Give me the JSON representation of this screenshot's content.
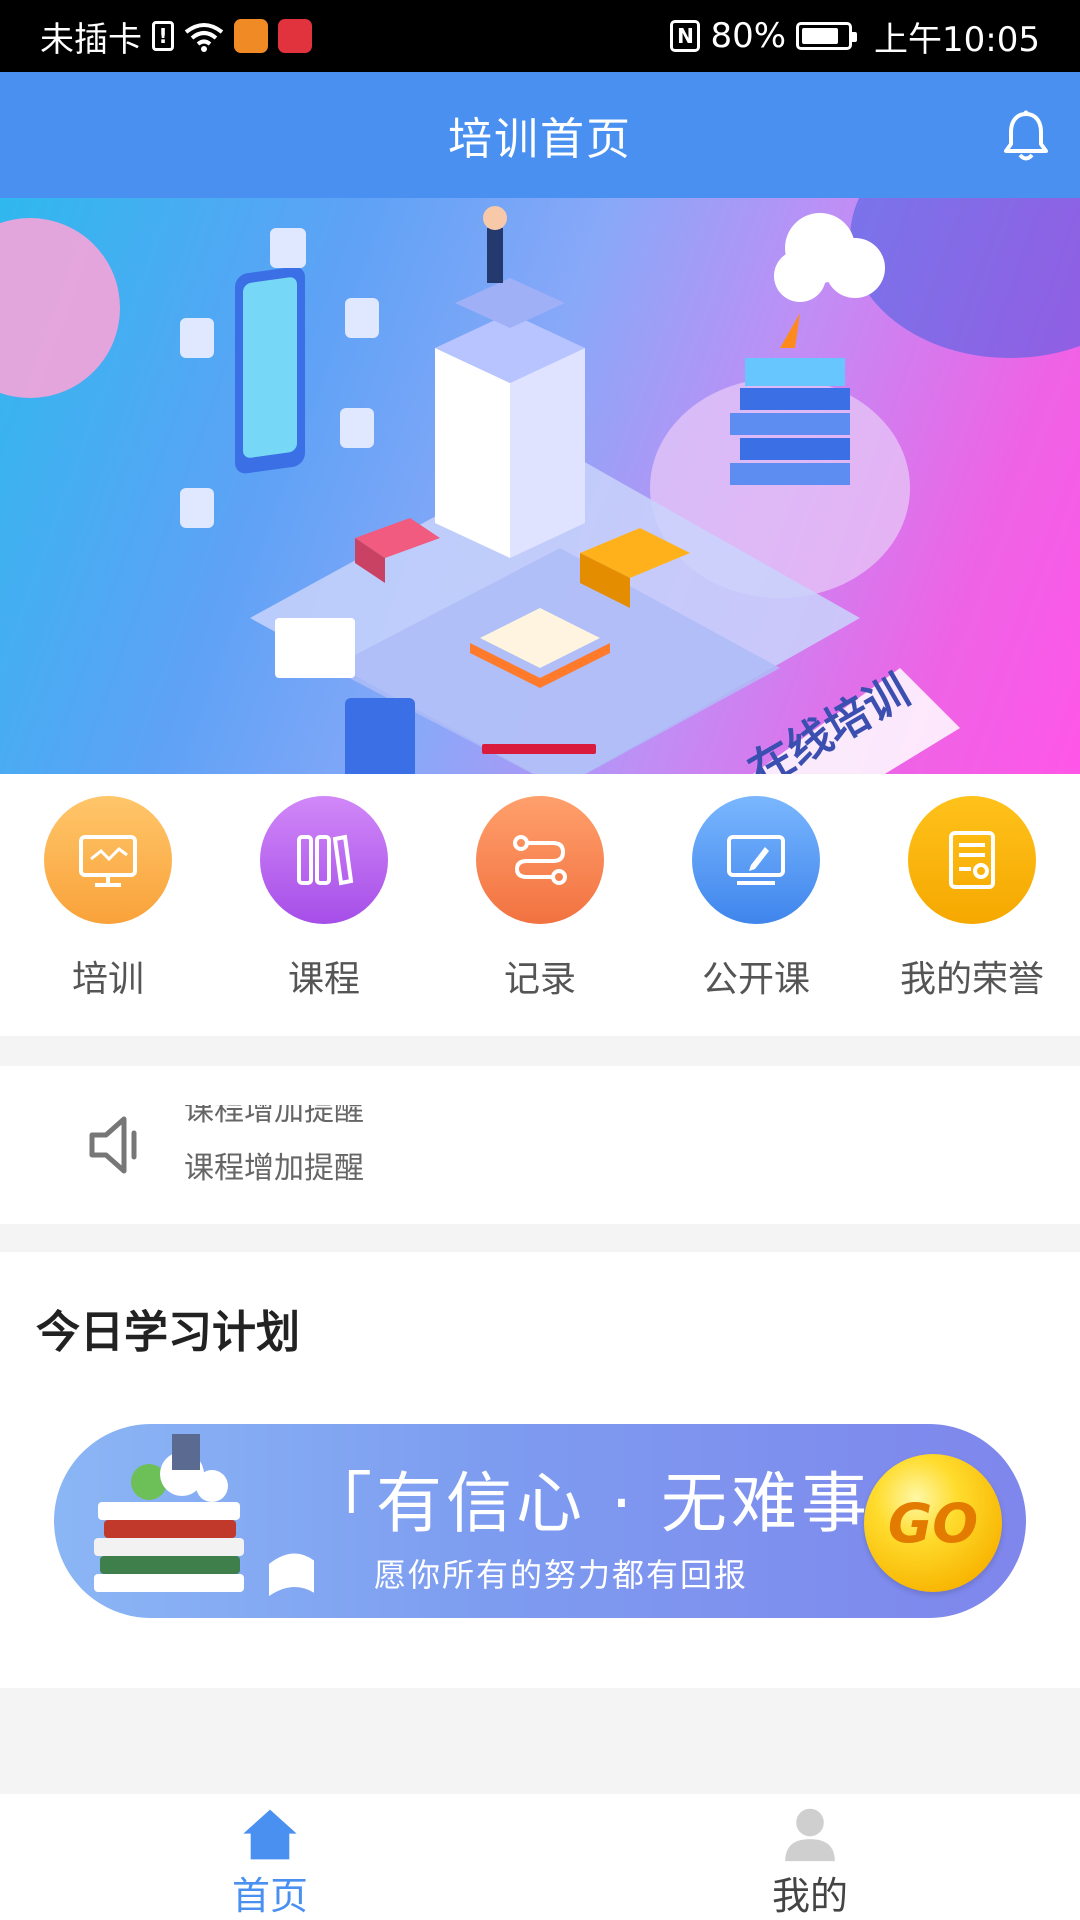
{
  "status_bar": {
    "carrier": "未插卡",
    "battery": "80%",
    "time": "上午10:05"
  },
  "header": {
    "title": "培训首页"
  },
  "banner": {
    "slide_text": "在线培训"
  },
  "menu": [
    {
      "label": "培训",
      "icon": "monitor-chart-icon",
      "color": "#f9a23a"
    },
    {
      "label": "课程",
      "icon": "books-icon",
      "color": "#a64ee8"
    },
    {
      "label": "记录",
      "icon": "route-icon",
      "color": "#f27241"
    },
    {
      "label": "公开课",
      "icon": "screen-pen-icon",
      "color": "#3f85ec"
    },
    {
      "label": "我的荣誉",
      "icon": "certificate-icon",
      "color": "#f5a800"
    }
  ],
  "notice": {
    "lines": [
      "课程增加提醒",
      "课程增加提醒"
    ]
  },
  "plan": {
    "title": "今日学习计划",
    "slogan": "「有信心 · 无难事」",
    "subtitle": "愿你所有的努力都有回报",
    "go_label": "GO"
  },
  "bottom_nav": {
    "items": [
      {
        "label": "首页",
        "icon": "home-icon",
        "active": true
      },
      {
        "label": "我的",
        "icon": "user-icon",
        "active": false
      }
    ]
  },
  "colors": {
    "primary": "#4a90f0",
    "indicator": "#d91c3e"
  }
}
